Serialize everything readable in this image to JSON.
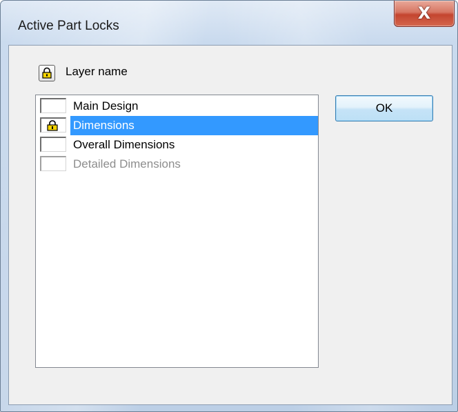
{
  "window": {
    "title": "Active Part Locks",
    "close_glyph": "X"
  },
  "header": {
    "icon": "lock-icon",
    "label": "Layer name"
  },
  "layers": [
    {
      "name": "Main Design",
      "locked": false,
      "selected": false,
      "enabled": true
    },
    {
      "name": "Dimensions",
      "locked": true,
      "selected": true,
      "enabled": true
    },
    {
      "name": "Overall Dimensions",
      "locked": false,
      "selected": false,
      "enabled": true
    },
    {
      "name": "Detailed Dimensions",
      "locked": false,
      "selected": false,
      "enabled": false
    }
  ],
  "buttons": {
    "ok_label": "OK"
  },
  "colors": {
    "selection": "#3399ff",
    "lock_gold": "#f5d400",
    "disabled_text": "#8d8d8d"
  }
}
